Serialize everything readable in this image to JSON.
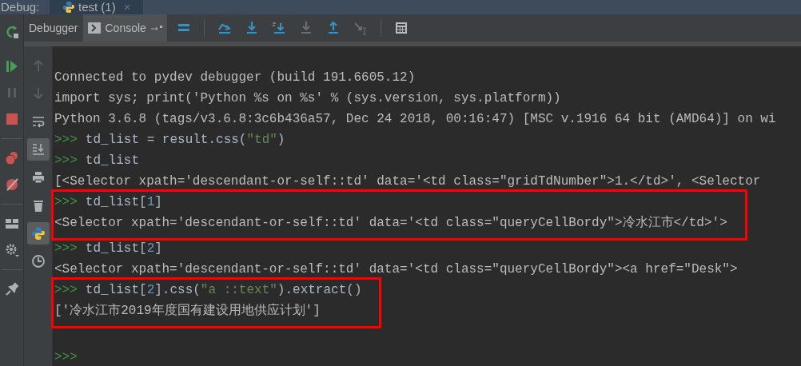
{
  "debug_bar": {
    "label": "Debug:",
    "tab": {
      "title": "test (1)",
      "close": "×",
      "selected": true
    }
  },
  "toolbar": {
    "rerun": {
      "kind": "rerun"
    },
    "tabs": [
      {
        "label": "Debugger",
        "selected": false,
        "kind": "plain"
      },
      {
        "label": "Console",
        "selected": true,
        "kind": "console"
      }
    ],
    "actions": [
      {
        "kind": "frames",
        "disabled": false
      },
      {
        "kind": "step-over",
        "disabled": false
      },
      {
        "kind": "step-into",
        "disabled": false
      },
      {
        "kind": "step-into-my-code",
        "disabled": false
      },
      {
        "kind": "force-step-into",
        "disabled": true
      },
      {
        "kind": "step-out",
        "disabled": false
      },
      {
        "kind": "run-to-cursor",
        "disabled": true
      },
      {
        "kind": "evaluate",
        "disabled": false
      }
    ]
  },
  "debug_actions": [
    {
      "kind": "resume",
      "disabled": false
    },
    {
      "kind": "pause",
      "disabled": true
    },
    {
      "kind": "stop",
      "disabled": false
    },
    {
      "kind": "breakpoints",
      "disabled": false
    },
    {
      "kind": "mute",
      "disabled": false
    },
    {
      "kind": "layout",
      "disabled": false
    },
    {
      "kind": "settings",
      "disabled": false
    },
    {
      "kind": "pin",
      "disabled": false
    }
  ],
  "console_actions": [
    {
      "kind": "up",
      "disabled": true,
      "selected": false
    },
    {
      "kind": "down",
      "disabled": true,
      "selected": false
    },
    {
      "kind": "wrap",
      "disabled": false,
      "selected": false
    },
    {
      "kind": "scroll-end",
      "disabled": false,
      "selected": true
    },
    {
      "kind": "print",
      "disabled": false,
      "selected": false
    },
    {
      "kind": "trash",
      "disabled": false,
      "selected": false
    },
    {
      "kind": "python",
      "disabled": false,
      "selected": true
    },
    {
      "kind": "history",
      "disabled": false,
      "selected": false
    }
  ],
  "console": [
    {
      "highlighted": false,
      "lines": [
        {
          "kind": "output",
          "text": "Connected to pydev debugger (build 191.6605.12)"
        },
        {
          "kind": "output",
          "text": "import sys; print('Python %s on %s' % (sys.version, sys.platform))"
        },
        {
          "kind": "output",
          "text": "Python 3.6.8 (tags/v3.6.8:3c6b436a57, Dec 24 2018, 00:16:47) [MSC v.1916 64 bit (AMD64)] on wi"
        },
        {
          "kind": "input",
          "prompt": ">>>",
          "parts": [
            {
              "kind": "code",
              "text": "td_list = result.css("
            },
            {
              "kind": "string",
              "text": "\"td\""
            },
            {
              "kind": "code",
              "text": ")"
            }
          ]
        },
        {
          "kind": "input",
          "prompt": ">>>",
          "parts": [
            {
              "kind": "code",
              "text": "td_list"
            }
          ]
        },
        {
          "kind": "output",
          "text": "[<Selector xpath='descendant-or-self::td' data='<td class=\"gridTdNumber\">1.</td>', <Selector"
        }
      ]
    },
    {
      "highlighted": true,
      "lines": [
        {
          "kind": "input",
          "prompt": ">>>",
          "parts": [
            {
              "kind": "code",
              "text": "td_list["
            },
            {
              "kind": "number",
              "text": "1"
            },
            {
              "kind": "code",
              "text": "]"
            }
          ]
        },
        {
          "kind": "output",
          "text": "<Selector xpath='descendant-or-self::td' data='<td class=\"queryCellBordy\">冷水江市</td>'>"
        }
      ]
    },
    {
      "highlighted": false,
      "lines": [
        {
          "kind": "input",
          "prompt": ">>>",
          "parts": [
            {
              "kind": "code",
              "text": "td_list["
            },
            {
              "kind": "number",
              "text": "2"
            },
            {
              "kind": "code",
              "text": "]"
            }
          ]
        },
        {
          "kind": "output",
          "text": "<Selector xpath='descendant-or-self::td' data='<td class=\"queryCellBordy\"><a href=\"Desk\">"
        }
      ]
    },
    {
      "highlighted": true,
      "lines": [
        {
          "kind": "input",
          "prompt": ">>>",
          "parts": [
            {
              "kind": "code",
              "text": "td_list["
            },
            {
              "kind": "number",
              "text": "2"
            },
            {
              "kind": "code",
              "text": "].css("
            },
            {
              "kind": "string",
              "text": "\"a ::text\""
            },
            {
              "kind": "code",
              "text": ").extract()"
            }
          ]
        },
        {
          "kind": "output",
          "text": "['冷水江市2019年度国有建设用地供应计划']"
        }
      ]
    },
    {
      "highlighted": false,
      "lines": [
        {
          "kind": "input",
          "prompt": ">>>"
        }
      ]
    }
  ]
}
